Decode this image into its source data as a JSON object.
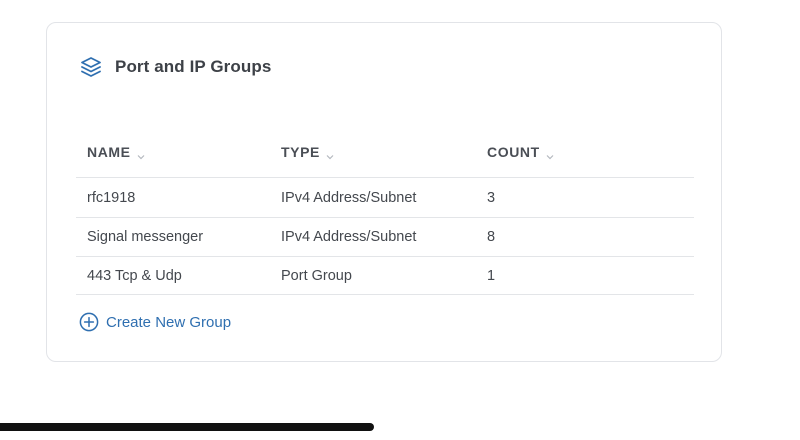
{
  "card": {
    "title": "Port and IP Groups",
    "icon": "layers-icon"
  },
  "table": {
    "columns": [
      {
        "label": "NAME",
        "sort_icon": "chevron-down-icon"
      },
      {
        "label": "TYPE",
        "sort_icon": "chevron-down-icon"
      },
      {
        "label": "COUNT",
        "sort_icon": "chevron-down-icon"
      }
    ],
    "rows": [
      {
        "name": "rfc1918",
        "type": "IPv4 Address/Subnet",
        "count": "3"
      },
      {
        "name": "Signal messenger",
        "type": "IPv4 Address/Subnet",
        "count": "8"
      },
      {
        "name": "443 Tcp & Udp",
        "type": "Port Group",
        "count": "1"
      }
    ]
  },
  "actions": {
    "create_label": "Create New Group",
    "create_icon": "plus-circle-icon"
  },
  "colors": {
    "accent": "#2f6fb0",
    "border": "#e2e4e8",
    "text": "#3a3d42"
  }
}
